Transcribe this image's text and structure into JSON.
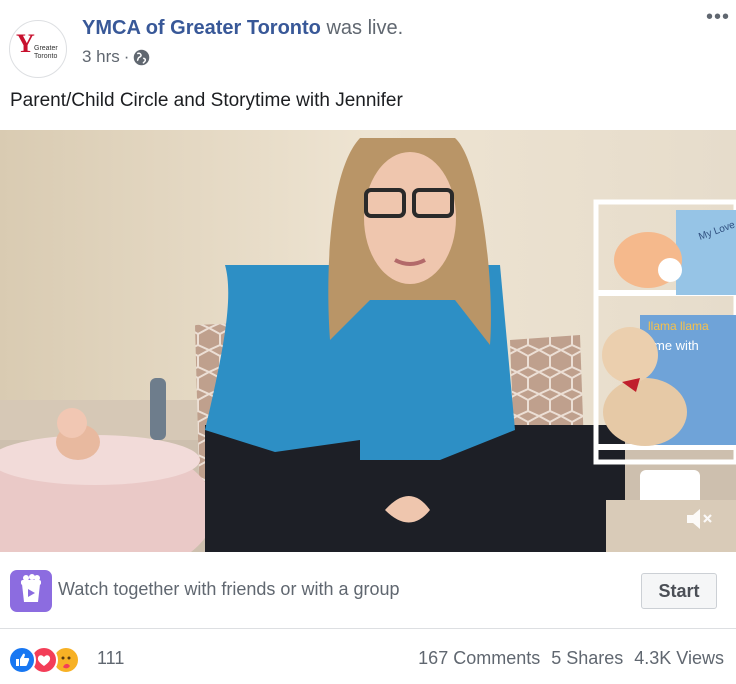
{
  "post": {
    "page_name": "YMCA of Greater Toronto",
    "title_suffix": "was live.",
    "time": "3 hrs",
    "separator": "·",
    "privacy_icon": "globe-icon",
    "more_label": "•••",
    "text": "Parent/Child Circle and Storytime with Jennifer",
    "avatar_logo_text": [
      "Greater",
      "Toronto"
    ]
  },
  "video": {
    "mute_icon": "muted-speaker-icon",
    "book_text_1": "My Love",
    "book_text_2": "llama llama",
    "book_text_3": "me with"
  },
  "watch_party": {
    "icon": "watch-party-icon",
    "prompt": "Watch together with friends or with a group",
    "start_label": "Start"
  },
  "footer": {
    "reaction_icons": [
      "like-icon",
      "love-icon",
      "care-icon"
    ],
    "reaction_count": "111",
    "comments": "167 Comments",
    "shares": "5 Shares",
    "views": "4.3K Views"
  },
  "colors": {
    "link": "#385898",
    "secondary_text": "#606770",
    "like_blue": "#1877f2",
    "love_red": "#f33e58",
    "care_yellow": "#f7b125",
    "watch_purple": "#8c6ce0",
    "ymca_red": "#c8102e"
  }
}
